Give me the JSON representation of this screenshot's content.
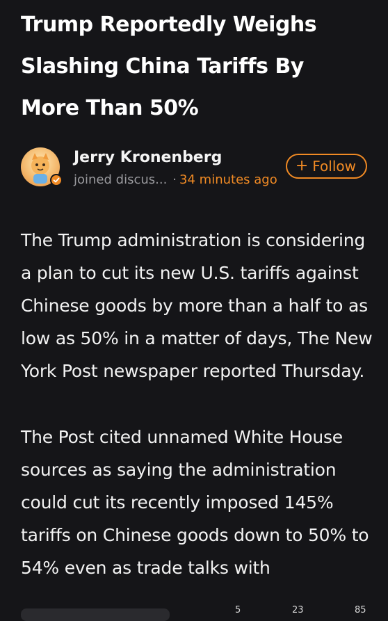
{
  "article": {
    "title": "Trump Reportedly Weighs Slashing China Tariffs By More Than 50%",
    "author": {
      "name": "Jerry Kronenberg",
      "joined": "joined discus...",
      "separator": "·",
      "time": "34 minutes ago",
      "avatar_icon": "cartoon-character-avatar",
      "badge_icon": "verified-badge-icon"
    },
    "follow": {
      "plus": "+",
      "label": "Follow"
    },
    "paragraphs": [
      "The Trump administration is considering a plan to cut its new U.S. tariffs against Chinese goods by more than a half to as low as 50% in a matter of days, The New York Post newspaper reported Thursday.",
      "The Post cited unnamed White House sources as saying the administration could cut its recently imposed 145% tariffs on Chinese goods down to 50% to 54% even as trade talks with"
    ]
  },
  "bottom_bar": {
    "counts": [
      "5",
      "23",
      "85"
    ]
  },
  "colors": {
    "background": "#151518",
    "accent": "#f08a24",
    "text": "#f2f2f2",
    "muted": "#9a9a9e"
  }
}
